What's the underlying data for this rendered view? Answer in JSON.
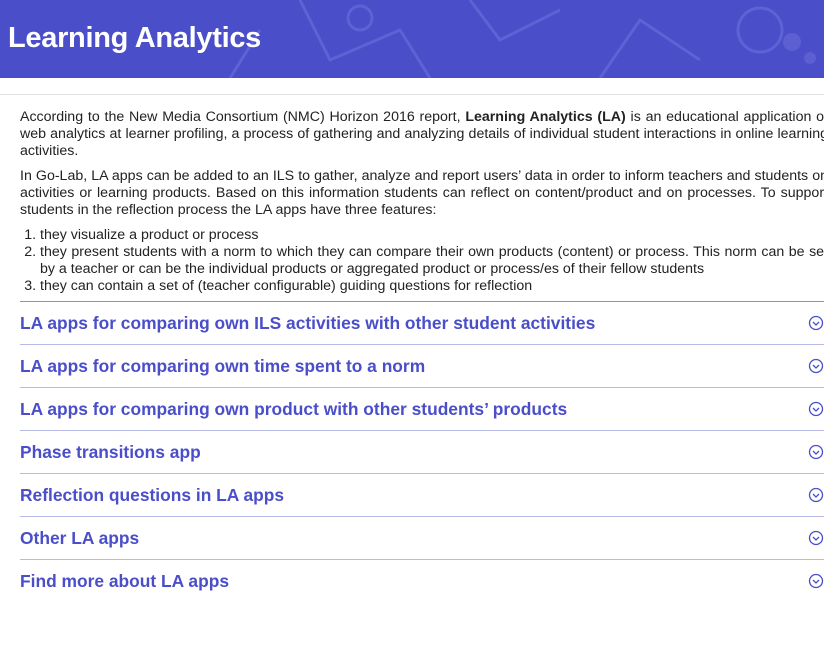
{
  "header": {
    "title": "Learning Analytics",
    "bg_color": "#4a4ec9"
  },
  "intro": {
    "p1_before": "According to the New Media Consortium (NMC) Horizon 2016 report, ",
    "p1_bold": "Learning Analytics (LA)",
    "p1_after": " is an educational application of web analytics at learner profiling, a process of gathering and analyzing details of individual student interactions in online learning activities.",
    "p2": "In Go-Lab, LA apps can be added to an ILS to gather, analyze and report users’ data in order to inform teachers and students on activities or learning products. Based on this information students can reflect on content/product and on processes. To support students in the reflection process the LA apps have three features:",
    "features": [
      "they visualize a product or process",
      "they present students with a norm to which they can compare their own products (content) or process. This norm can be set by a teacher or can be the individual products or aggregated product or process/es of their fellow students",
      "they can contain a set of (teacher configurable) guiding questions for reflection"
    ]
  },
  "accordion": {
    "accent_color": "#4a4ec9",
    "icon": "chevron-down-circle-icon",
    "items": [
      "LA apps for comparing own ILS activities with other student activities",
      "LA apps for comparing own time spent to a norm",
      "LA apps for comparing own product with other students’ products",
      "Phase transitions app",
      "Reflection questions in LA apps",
      "Other LA apps",
      "Find more about LA apps"
    ]
  }
}
